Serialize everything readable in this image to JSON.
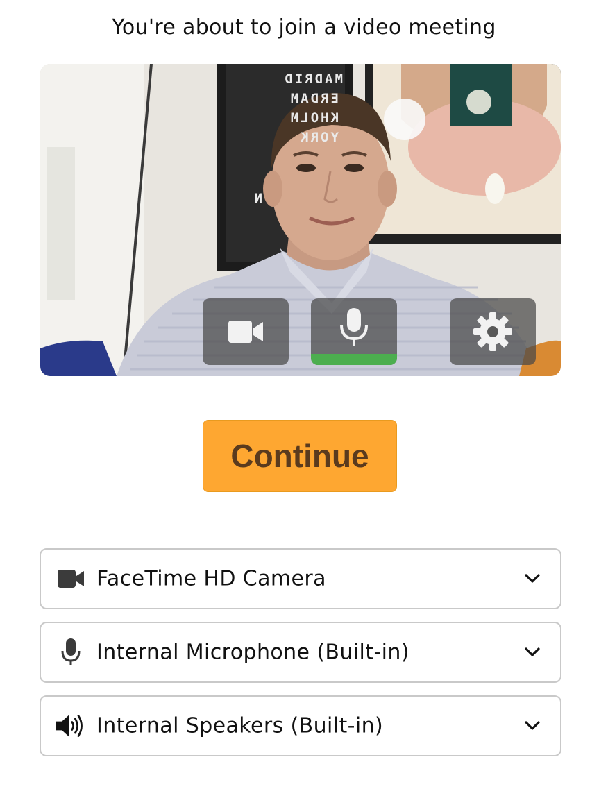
{
  "header": {
    "title": "You're about to join a video meeting"
  },
  "preview": {
    "poster_text": [
      "MADRID",
      "ERDAM",
      "KHOLM",
      "YORK",
      "N"
    ],
    "controls": {
      "camera_icon": "video-camera-icon",
      "mic_icon": "microphone-icon",
      "settings_icon": "gear-icon",
      "mic_level": 1.0,
      "mic_level_color": "#4cae4f"
    }
  },
  "actions": {
    "continue_label": "Continue",
    "continue_color": "#fea731"
  },
  "devices": {
    "camera": {
      "icon": "video-camera-icon",
      "value": "FaceTime HD Camera"
    },
    "microphone": {
      "icon": "microphone-icon",
      "value": "Internal Microphone (Built-in)"
    },
    "speakers": {
      "icon": "speaker-icon",
      "value": "Internal Speakers (Built-in)"
    }
  }
}
